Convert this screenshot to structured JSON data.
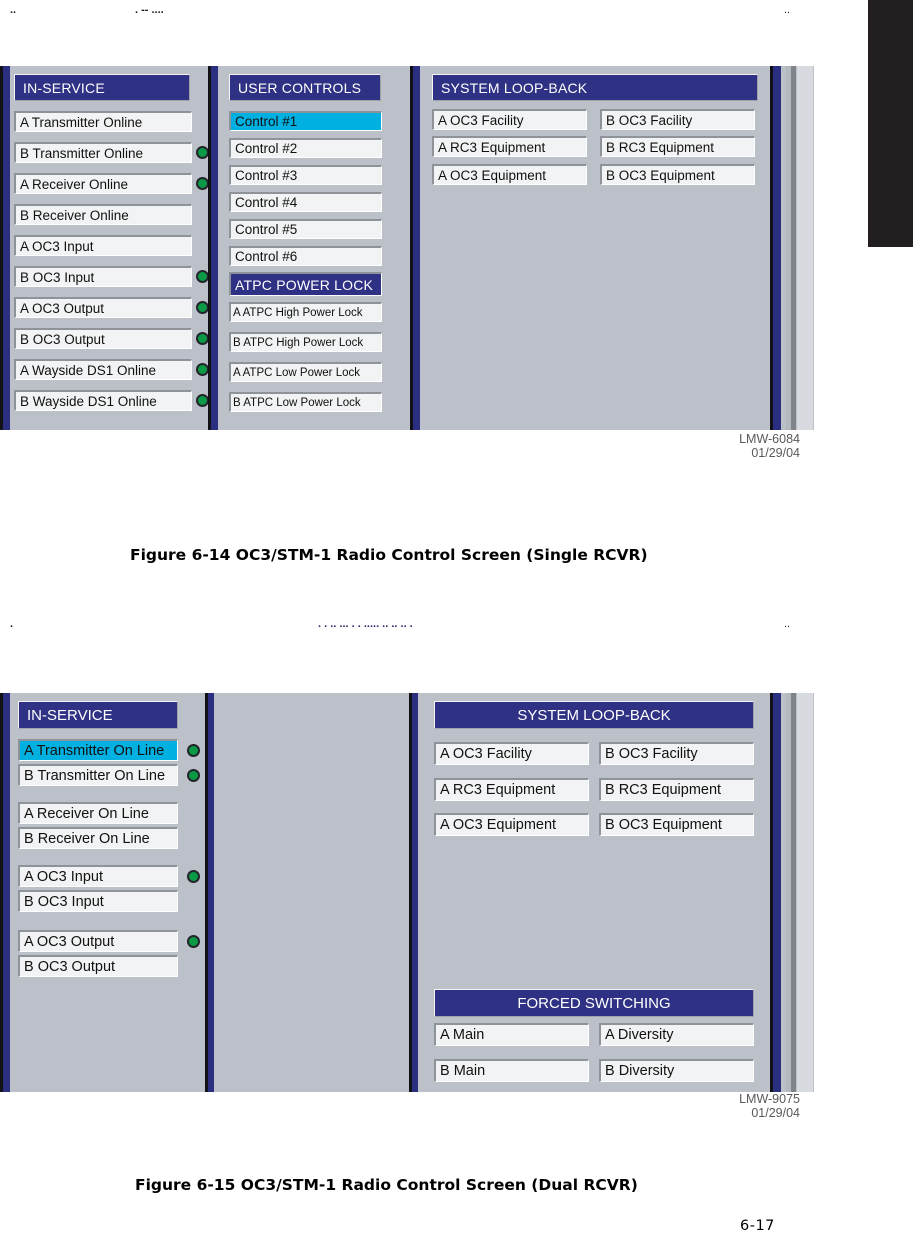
{
  "page": {
    "page_number": "6-17",
    "top_artifact_left": "..",
    "top_artifact_center": ". -- ....",
    "top_artifact_right": "..",
    "mid_artifact_left": ".",
    "mid_artifact_center": ". . .. ... . . ..... .. .. ..  .",
    "mid_artifact_right": ".."
  },
  "figure1": {
    "caption": "Figure 6-14  OC3/STM-1 Radio Control Screen (Single RCVR)",
    "stamp_id": "LMW-6084",
    "stamp_date": "01/29/04",
    "panels": [
      {
        "title": "IN-SERVICE",
        "items": [
          {
            "label": "A Transmitter Online",
            "led": false,
            "selected": false
          },
          {
            "label": "B Transmitter Online",
            "led": true,
            "selected": false
          },
          {
            "label": "A Receiver Online",
            "led": true,
            "selected": false
          },
          {
            "label": "B Receiver Online",
            "led": false,
            "selected": false
          },
          {
            "label": "A OC3 Input",
            "led": false,
            "selected": false
          },
          {
            "label": "B OC3 Input",
            "led": true,
            "selected": false
          },
          {
            "label": "A OC3 Output",
            "led": true,
            "selected": false
          },
          {
            "label": "B OC3 Output",
            "led": true,
            "selected": false
          },
          {
            "label": "A Wayside DS1 Online",
            "led": true,
            "selected": false
          },
          {
            "label": "B Wayside DS1 Online",
            "led": true,
            "selected": false
          }
        ]
      },
      {
        "title": "USER CONTROLS",
        "items": [
          {
            "label": "Control #1",
            "selected": true
          },
          {
            "label": "Control #2",
            "selected": false
          },
          {
            "label": "Control #3",
            "selected": false
          },
          {
            "label": "Control #4",
            "selected": false
          },
          {
            "label": "Control #5",
            "selected": false
          },
          {
            "label": "Control #6",
            "selected": false
          }
        ],
        "subheader": "ATPC POWER LOCK",
        "sub_items": [
          {
            "label": "A ATPC High Power Lock"
          },
          {
            "label": "B ATPC High Power Lock"
          },
          {
            "label": "A ATPC Low Power Lock"
          },
          {
            "label": "B ATPC Low Power Lock"
          }
        ]
      },
      {
        "title": "SYSTEM LOOP-BACK",
        "rows": [
          {
            "left": "A OC3 Facility",
            "right": "B OC3 Facility"
          },
          {
            "left": "A RC3 Equipment",
            "right": "B RC3 Equipment"
          },
          {
            "left": "A OC3 Equipment",
            "right": "B OC3 Equipment"
          }
        ]
      }
    ]
  },
  "figure2": {
    "caption": "Figure 6-15  OC3/STM-1 Radio Control Screen (Dual RCVR)",
    "stamp_id": "LMW-9075",
    "stamp_date": "01/29/04",
    "panels": [
      {
        "title": "IN-SERVICE",
        "items": [
          {
            "label": "A Transmitter On Line",
            "led": true,
            "selected": true
          },
          {
            "label": "B Transmitter On Line",
            "led": true,
            "selected": false
          },
          {
            "label": "A Receiver On Line",
            "led": false,
            "selected": false
          },
          {
            "label": "B Receiver On Line",
            "led": false,
            "selected": false
          },
          {
            "label": "A OC3 Input",
            "led": true,
            "selected": false
          },
          {
            "label": "B OC3 Input",
            "led": false,
            "selected": false
          },
          {
            "label": "A OC3 Output",
            "led": true,
            "selected": false
          },
          {
            "label": "B OC3 Output",
            "led": false,
            "selected": false
          }
        ]
      },
      {
        "title": "",
        "items": []
      },
      {
        "title": "SYSTEM LOOP-BACK",
        "rows": [
          {
            "left": "A OC3 Facility",
            "right": "B OC3 Facility"
          },
          {
            "left": "A RC3 Equipment",
            "right": "B RC3 Equipment"
          },
          {
            "left": "A OC3 Equipment",
            "right": "B OC3 Equipment"
          }
        ],
        "subheader": "FORCED SWITCHING",
        "sub_rows": [
          {
            "left": "A Main",
            "right": "A Diversity"
          },
          {
            "left": "B Main",
            "right": "B Diversity"
          }
        ]
      }
    ]
  },
  "colors": {
    "header_navy": "#2e3184",
    "selected_cyan": "#00b0e0",
    "led_green": "#0a9a45",
    "panel_gray": "#bcc0c8",
    "item_face": "#f2f3f4"
  }
}
